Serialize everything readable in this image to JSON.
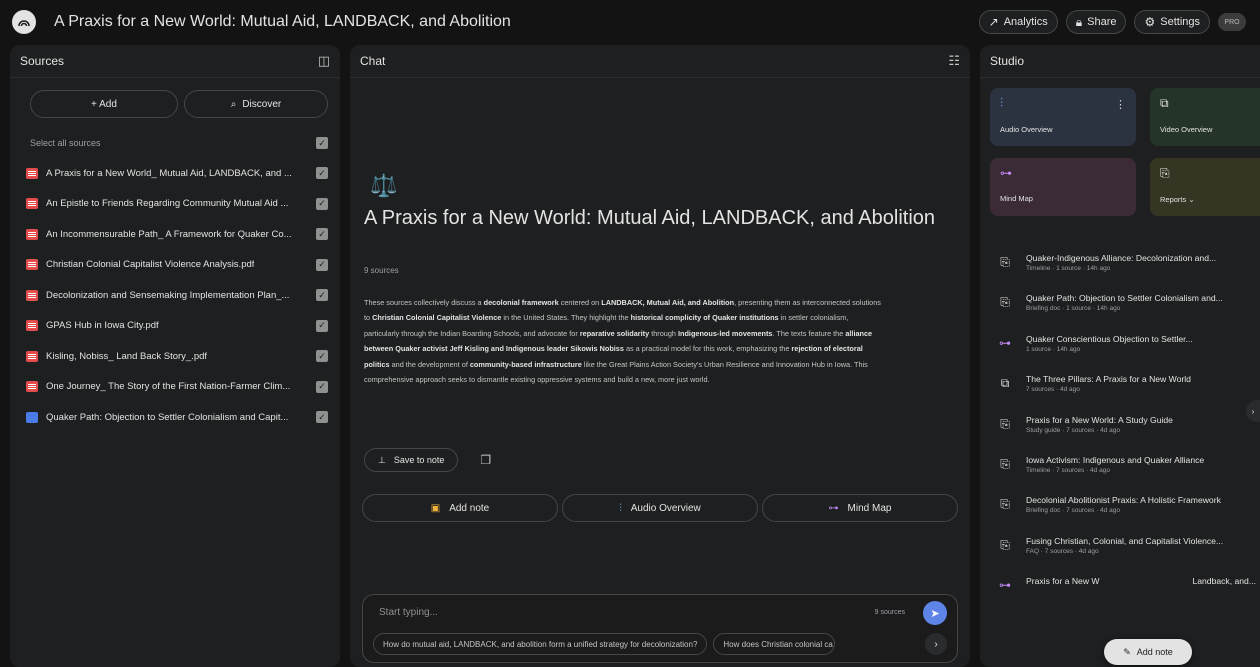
{
  "app": {
    "notebook_title": "A Praxis for a New World: Mutual Aid, LANDBACK, and Abolition",
    "actions": {
      "analytics": "Analytics",
      "share": "Share",
      "settings": "Settings",
      "pro_badge": "PRO"
    }
  },
  "sources": {
    "header": "Sources",
    "add_label": "+ Add",
    "discover_label": "Discover",
    "select_all": "Select all sources",
    "items": [
      {
        "label": "A Praxis for a New World_ Mutual Aid, LANDBACK, and ...",
        "type": "pdf"
      },
      {
        "label": "An Epistle to Friends Regarding Community Mutual Aid ...",
        "type": "pdf"
      },
      {
        "label": "An Incommensurable Path_ A Framework for Quaker Co...",
        "type": "pdf"
      },
      {
        "label": "Christian Colonial Capitalist Violence Analysis.pdf",
        "type": "pdf"
      },
      {
        "label": "Decolonization and Sensemaking Implementation Plan_...",
        "type": "pdf"
      },
      {
        "label": "GPAS Hub in Iowa City.pdf",
        "type": "pdf"
      },
      {
        "label": "Kisling, Nobiss_ Land Back Story_.pdf",
        "type": "pdf"
      },
      {
        "label": "One Journey_ The Story of the First Nation-Farmer Clim...",
        "type": "pdf"
      },
      {
        "label": "Quaker Path: Objection to Settler Colonialism and Capit...",
        "type": "doc"
      }
    ]
  },
  "chat": {
    "header": "Chat",
    "emoji": "⚖️",
    "title": "A Praxis for a New World: Mutual Aid, LANDBACK, and Abolition",
    "source_count": "9 sources",
    "summary_segments": [
      {
        "t": "These sources collectively discuss a ",
        "b": false
      },
      {
        "t": "decolonial framework",
        "b": true
      },
      {
        "t": " centered on ",
        "b": false
      },
      {
        "t": "LANDBACK, Mutual Aid, and Abolition",
        "b": true
      },
      {
        "t": ", presenting them as interconnected solutions to ",
        "b": false
      },
      {
        "t": "Christian Colonial Capitalist Violence",
        "b": true
      },
      {
        "t": " in the United States. They highlight the ",
        "b": false
      },
      {
        "t": "historical complicity of Quaker institutions",
        "b": true
      },
      {
        "t": " in settler colonialism, particularly through the Indian Boarding Schools, and advocate for ",
        "b": false
      },
      {
        "t": "reparative solidarity",
        "b": true
      },
      {
        "t": " through ",
        "b": false
      },
      {
        "t": "Indigenous-led movements",
        "b": true
      },
      {
        "t": ". The texts feature the ",
        "b": false
      },
      {
        "t": "alliance between Quaker activist Jeff Kisling and Indigenous leader Sikowis Nobiss",
        "b": true
      },
      {
        "t": " as a practical model for this work, emphasizing the ",
        "b": false
      },
      {
        "t": "rejection of electoral politics",
        "b": true
      },
      {
        "t": " and the development of ",
        "b": false
      },
      {
        "t": "community-based infrastructure",
        "b": true
      },
      {
        "t": " like the Great Plains Action Society's Urban Resilience and Innovation Hub in Iowa. This comprehensive approach seeks to dismantle existing oppressive systems and build a new, more just world.",
        "b": false
      }
    ],
    "save_to_note": "Save to note",
    "actions": {
      "add_note": "Add note",
      "audio_overview": "Audio Overview",
      "mind_map": "Mind Map"
    },
    "input": {
      "placeholder": "Start typing...",
      "source_count": "9 sources"
    },
    "suggestions": [
      "How do mutual aid, LANDBACK, and abolition form a unified strategy for decolonization?",
      "How does Christian colonial ca"
    ]
  },
  "studio": {
    "header": "Studio",
    "tiles": {
      "audio_overview": "Audio Overview",
      "video_overview": "Video Overview",
      "mind_map": "Mind Map",
      "reports": "Reports"
    },
    "tile_colors": {
      "audio": "#2b3340",
      "video": "#253428",
      "mindmap": "#3a2b36",
      "reports": "#363523"
    },
    "items": [
      {
        "title": "Quaker-Indigenous Alliance: Decolonization and...",
        "sub": "Timeline · 1 source · 14h ago",
        "icon": "report-icon"
      },
      {
        "title": "Quaker Path: Objection to Settler Colonialism and...",
        "sub": "Briefing doc · 1 source · 14h ago",
        "icon": "report-icon"
      },
      {
        "title": "Quaker Conscientious Objection to Settler...",
        "sub": "1 source · 14h ago",
        "icon": "mind-map-icon"
      },
      {
        "title": "The Three Pillars: A Praxis for a New World",
        "sub": "7 sources · 4d ago",
        "icon": "video-icon"
      },
      {
        "title": "Praxis for a New World: A Study Guide",
        "sub": "Study guide · 7 sources · 4d ago",
        "icon": "report-icon"
      },
      {
        "title": "Iowa Activism: Indigenous and Quaker Alliance",
        "sub": "Timeline · 7 sources · 4d ago",
        "icon": "report-icon"
      },
      {
        "title": "Decolonial Abolitionist Praxis: A Holistic Framework",
        "sub": "Briefing doc · 7 sources · 4d ago",
        "icon": "report-icon"
      },
      {
        "title": "Fusing Christian, Colonial, and Capitalist Violence...",
        "sub": "FAQ · 7 sources · 4d ago",
        "icon": "report-icon"
      },
      {
        "title": "Praxis for a New W",
        "sub": "",
        "tail": "Landback, and...",
        "icon": "mind-map-icon"
      }
    ],
    "floating_add_note": "Add note"
  }
}
